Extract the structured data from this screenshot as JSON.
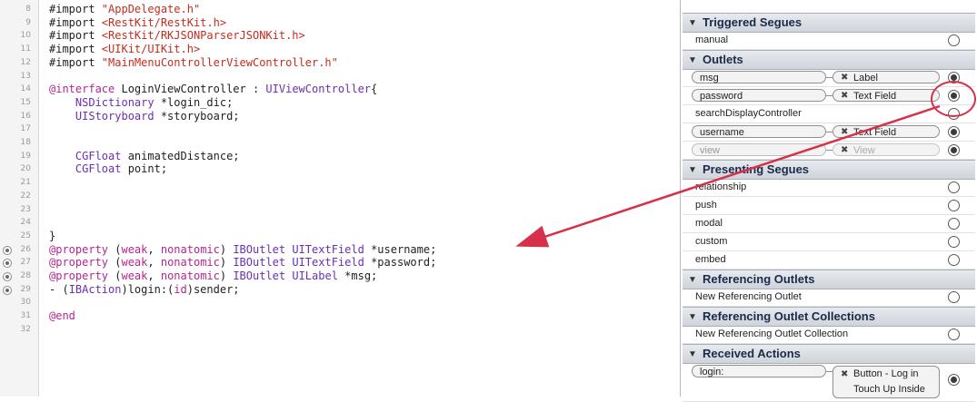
{
  "editor": {
    "lines": [
      {
        "n": "8",
        "parts": [
          [
            "plain",
            "#import "
          ],
          [
            "str",
            "\"AppDelegate.h\""
          ]
        ]
      },
      {
        "n": "9",
        "parts": [
          [
            "plain",
            "#import "
          ],
          [
            "str",
            "<RestKit/RestKit.h>"
          ]
        ]
      },
      {
        "n": "10",
        "parts": [
          [
            "plain",
            "#import "
          ],
          [
            "str",
            "<RestKit/RKJSONParserJSONKit.h>"
          ]
        ]
      },
      {
        "n": "11",
        "parts": [
          [
            "plain",
            "#import "
          ],
          [
            "str",
            "<UIKit/UIKit.h>"
          ]
        ]
      },
      {
        "n": "12",
        "parts": [
          [
            "plain",
            "#import "
          ],
          [
            "str",
            "\"MainMenuControllerViewController.h\""
          ]
        ]
      },
      {
        "n": "13",
        "parts": []
      },
      {
        "n": "14",
        "parts": [
          [
            "kw",
            "@interface"
          ],
          [
            "plain",
            " LoginViewController : "
          ],
          [
            "type",
            "UIViewController"
          ],
          [
            "plain",
            "{"
          ]
        ]
      },
      {
        "n": "15",
        "parts": [
          [
            "plain",
            "    "
          ],
          [
            "type",
            "NSDictionary"
          ],
          [
            "plain",
            " *login_dic;"
          ]
        ]
      },
      {
        "n": "16",
        "parts": [
          [
            "plain",
            "    "
          ],
          [
            "type",
            "UIStoryboard"
          ],
          [
            "plain",
            " *storyboard;"
          ]
        ]
      },
      {
        "n": "17",
        "parts": []
      },
      {
        "n": "18",
        "parts": []
      },
      {
        "n": "19",
        "parts": [
          [
            "plain",
            "    "
          ],
          [
            "type",
            "CGFloat"
          ],
          [
            "plain",
            " animatedDistance;"
          ]
        ]
      },
      {
        "n": "20",
        "parts": [
          [
            "plain",
            "    "
          ],
          [
            "type",
            "CGFloat"
          ],
          [
            "plain",
            " point;"
          ]
        ]
      },
      {
        "n": "21",
        "parts": []
      },
      {
        "n": "22",
        "parts": []
      },
      {
        "n": "23",
        "parts": []
      },
      {
        "n": "24",
        "parts": []
      },
      {
        "n": "25",
        "parts": [
          [
            "plain",
            "}"
          ]
        ]
      },
      {
        "n": "26",
        "conn": true,
        "parts": [
          [
            "kw",
            "@property"
          ],
          [
            "plain",
            " ("
          ],
          [
            "kw",
            "weak"
          ],
          [
            "plain",
            ", "
          ],
          [
            "kw",
            "nonatomic"
          ],
          [
            "plain",
            ") "
          ],
          [
            "type",
            "IBOutlet"
          ],
          [
            "plain",
            " "
          ],
          [
            "type",
            "UITextField"
          ],
          [
            "plain",
            " *username;"
          ]
        ]
      },
      {
        "n": "27",
        "conn": true,
        "parts": [
          [
            "kw",
            "@property"
          ],
          [
            "plain",
            " ("
          ],
          [
            "kw",
            "weak"
          ],
          [
            "plain",
            ", "
          ],
          [
            "kw",
            "nonatomic"
          ],
          [
            "plain",
            ") "
          ],
          [
            "type",
            "IBOutlet"
          ],
          [
            "plain",
            " "
          ],
          [
            "type",
            "UITextField"
          ],
          [
            "plain",
            " *password;"
          ]
        ]
      },
      {
        "n": "28",
        "conn": true,
        "parts": [
          [
            "kw",
            "@property"
          ],
          [
            "plain",
            " ("
          ],
          [
            "kw",
            "weak"
          ],
          [
            "plain",
            ", "
          ],
          [
            "kw",
            "nonatomic"
          ],
          [
            "plain",
            ") "
          ],
          [
            "type",
            "IBOutlet"
          ],
          [
            "plain",
            " "
          ],
          [
            "type",
            "UILabel"
          ],
          [
            "plain",
            " *msg;"
          ]
        ]
      },
      {
        "n": "29",
        "conn": true,
        "parts": [
          [
            "plain",
            "- ("
          ],
          [
            "type",
            "IBAction"
          ],
          [
            "plain",
            ")login:("
          ],
          [
            "kw",
            "id"
          ],
          [
            "plain",
            ")sender;"
          ]
        ]
      },
      {
        "n": "30",
        "parts": []
      },
      {
        "n": "31",
        "parts": [
          [
            "kw",
            "@end"
          ]
        ]
      },
      {
        "n": "32",
        "parts": []
      }
    ]
  },
  "inspector": {
    "triggered_segues": {
      "title": "Triggered Segues",
      "items": [
        {
          "label": "manual"
        }
      ]
    },
    "outlets": {
      "title": "Outlets",
      "items": [
        {
          "label": "msg",
          "target": "Label",
          "on": true
        },
        {
          "label": "password",
          "target": "Text Field",
          "on": true
        },
        {
          "label": "searchDisplayController"
        },
        {
          "label": "username",
          "target": "Text Field",
          "on": true
        },
        {
          "label": "view",
          "target": "View",
          "on": true,
          "dim": true
        }
      ]
    },
    "presenting_segues": {
      "title": "Presenting Segues",
      "items": [
        {
          "label": "relationship"
        },
        {
          "label": "push"
        },
        {
          "label": "modal"
        },
        {
          "label": "custom"
        },
        {
          "label": "embed"
        }
      ]
    },
    "referencing_outlets": {
      "title": "Referencing Outlets",
      "items": [
        {
          "label": "New Referencing Outlet"
        }
      ]
    },
    "referencing_outlet_collections": {
      "title": "Referencing Outlet Collections",
      "items": [
        {
          "label": "New Referencing Outlet Collection"
        }
      ]
    },
    "received_actions": {
      "title": "Received Actions",
      "items": [
        {
          "label": "login:",
          "target_line1": "Button - Log in",
          "target_line2": "Touch Up Inside",
          "on": true
        }
      ]
    }
  },
  "colors": {
    "keyword": "#b5268f",
    "string": "#c42d1f",
    "type": "#6a2fb3",
    "annotation": "#d6304a"
  }
}
